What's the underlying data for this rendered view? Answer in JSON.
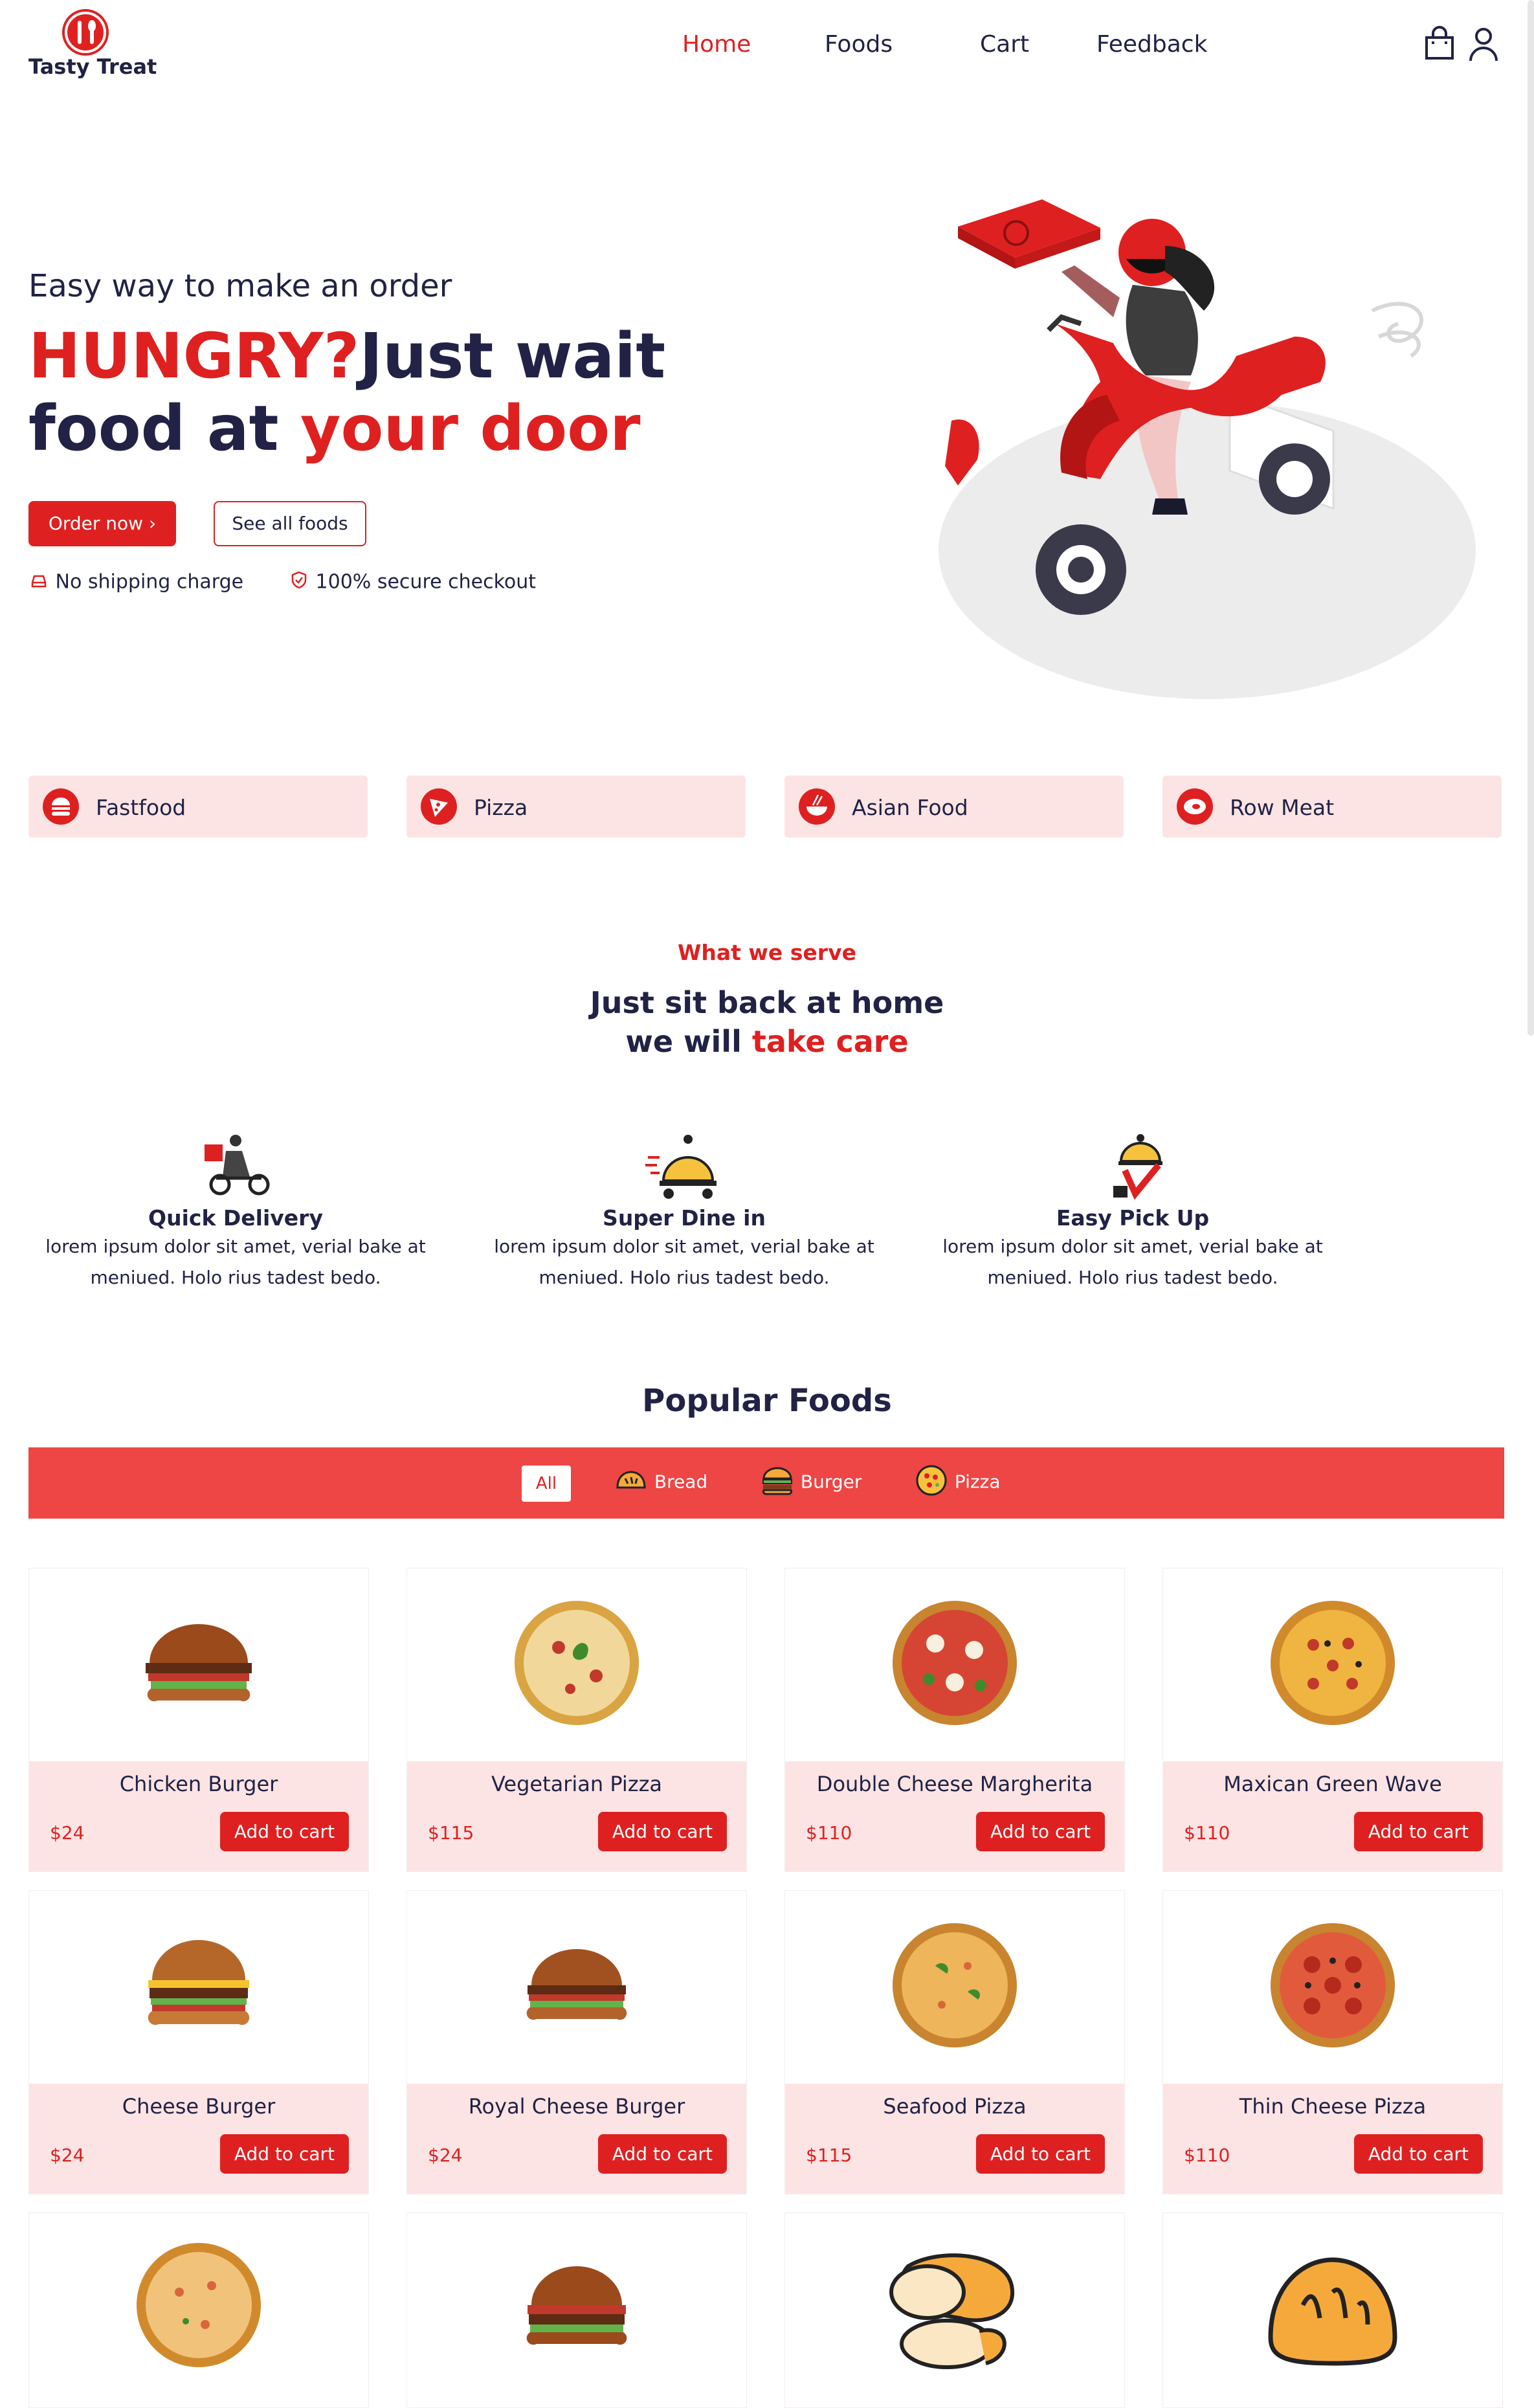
{
  "header": {
    "logo_text": "Tasty Treat",
    "nav": [
      "Home",
      "Foods",
      "Cart",
      "Feedback"
    ],
    "cart_icon": "shopping-bag-icon",
    "user_icon": "user-icon"
  },
  "hero": {
    "subtitle": "Easy way to make an order",
    "title_red_1": "HUNGRY?",
    "title_dark_1": "Just wait",
    "title_dark_2": "food at ",
    "title_red_2": "your door",
    "order_btn": "Order now",
    "see_all_btn": "See all foods",
    "note_1": "No shipping charge",
    "note_2": "100% secure checkout"
  },
  "categories": [
    "Fastfood",
    "Pizza",
    "Asian Food",
    "Row Meat"
  ],
  "serve": {
    "kicker": "What we serve",
    "title_1": "Just sit back at home",
    "title_2a": "we will ",
    "title_2b": "take care",
    "features": [
      {
        "title": "Quick Delivery",
        "desc_1": "lorem ipsum dolor sit amet, verial bake at",
        "desc_2": "meniued. Holo rius tadest bedo."
      },
      {
        "title": "Super Dine in",
        "desc_1": "lorem ipsum dolor sit amet, verial bake at",
        "desc_2": "meniued. Holo rius tadest bedo."
      },
      {
        "title": "Easy Pick Up",
        "desc_1": "lorem ipsum dolor sit amet, verial bake at",
        "desc_2": "meniued. Holo rius tadest bedo."
      }
    ]
  },
  "popular": {
    "title": "Popular Foods",
    "filters": [
      "All",
      "Bread",
      "Burger",
      "Pizza"
    ],
    "add_label": "Add to cart",
    "products": [
      {
        "name": "Chicken Burger",
        "price": "$24",
        "kind": "burger"
      },
      {
        "name": "Vegetarian Pizza",
        "price": "$115",
        "kind": "pizza"
      },
      {
        "name": "Double Cheese Margherita",
        "price": "$110",
        "kind": "pizza"
      },
      {
        "name": "Maxican Green Wave",
        "price": "$110",
        "kind": "pizza"
      },
      {
        "name": "Cheese Burger",
        "price": "$24",
        "kind": "burger"
      },
      {
        "name": "Royal Cheese Burger",
        "price": "$24",
        "kind": "burger"
      },
      {
        "name": "Seafood Pizza",
        "price": "$115",
        "kind": "pizza"
      },
      {
        "name": "Thin Cheese Pizza",
        "price": "$110",
        "kind": "pizza"
      }
    ]
  },
  "colors": {
    "accent": "#df2020",
    "dark": "#212245",
    "soft": "#fde4e4",
    "bar": "#ee4545"
  }
}
